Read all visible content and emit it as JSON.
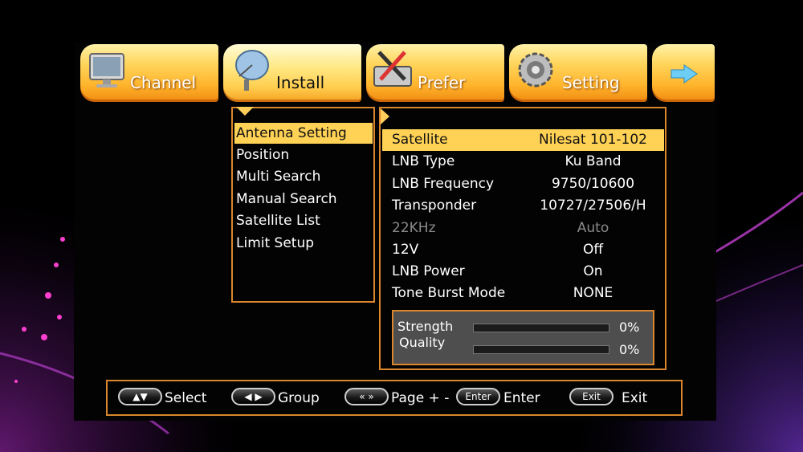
{
  "tabs": [
    {
      "label": "Channel",
      "icon": "tv-monitor-icon"
    },
    {
      "label": "Install",
      "icon": "satellite-dish-icon",
      "active": true
    },
    {
      "label": "Prefer",
      "icon": "tools-icon"
    },
    {
      "label": "Setting",
      "icon": "gear-icon"
    },
    {
      "label": "",
      "icon": "arrow-right-icon"
    }
  ],
  "submenu": {
    "items": [
      "Antenna Setting",
      "Position",
      "Multi Search",
      "Manual Search",
      "Satellite List",
      "Limit Setup"
    ],
    "selected_index": 0
  },
  "settings": {
    "rows": [
      {
        "key": "Satellite",
        "value": "Nilesat 101-102"
      },
      {
        "key": "LNB Type",
        "value": "Ku Band"
      },
      {
        "key": "LNB Frequency",
        "value": "9750/10600"
      },
      {
        "key": "Transponder",
        "value": "10727/27506/H"
      },
      {
        "key": "22KHz",
        "value": "Auto"
      },
      {
        "key": "12V",
        "value": "Off"
      },
      {
        "key": "LNB Power",
        "value": "On"
      },
      {
        "key": "Tone Burst Mode",
        "value": "NONE"
      }
    ]
  },
  "signal": {
    "strength_label": "Strength",
    "strength_value": "0%",
    "quality_label": "Quality",
    "quality_value": "0%"
  },
  "help": {
    "select_label": "Select",
    "group_label": "Group",
    "page_label": "Page + -",
    "enter_key": "Enter",
    "enter_label": "Enter",
    "exit_key": "Exit",
    "exit_label": "Exit"
  },
  "colors": {
    "accent": "#ffd255",
    "border": "#d9862c",
    "tab_gradient_bottom": "#f08a10"
  }
}
